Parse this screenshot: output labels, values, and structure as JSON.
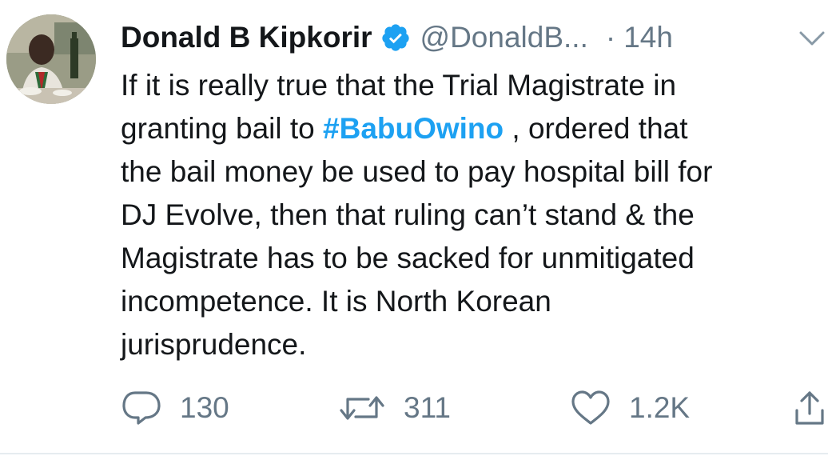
{
  "tweet": {
    "author_name": "Donald B Kipkorir",
    "handle": "@DonaldB...",
    "separator": "·",
    "time": "14h",
    "text_lines": [
      {
        "before": "If it is really true that the Trial Magistrate in",
        "hashtag": "",
        "after": ""
      },
      {
        "before": "granting bail to ",
        "hashtag": "#BabuOwino",
        "after": " , ordered that"
      },
      {
        "before": "the bail money be used to pay hospital bill for",
        "hashtag": "",
        "after": ""
      },
      {
        "before": "DJ Evolve, then that ruling can’t stand & the",
        "hashtag": "",
        "after": ""
      },
      {
        "before": "Magistrate has to be sacked for unmitigated",
        "hashtag": "",
        "after": ""
      },
      {
        "before": "incompetence. It is North Korean",
        "hashtag": "",
        "after": ""
      },
      {
        "before": "jurisprudence.",
        "hashtag": "",
        "after": ""
      }
    ]
  },
  "actions": {
    "reply_count": "130",
    "retweet_count": "311",
    "like_count": "1.2K"
  },
  "icons": {
    "verified": "verified-badge-icon",
    "caret": "chevron-down-icon",
    "reply": "reply-bubble-icon",
    "retweet": "retweet-icon",
    "like": "heart-icon",
    "share": "share-icon"
  },
  "colors": {
    "text": "#14171a",
    "muted": "#657786",
    "accent": "#1da1f2"
  }
}
